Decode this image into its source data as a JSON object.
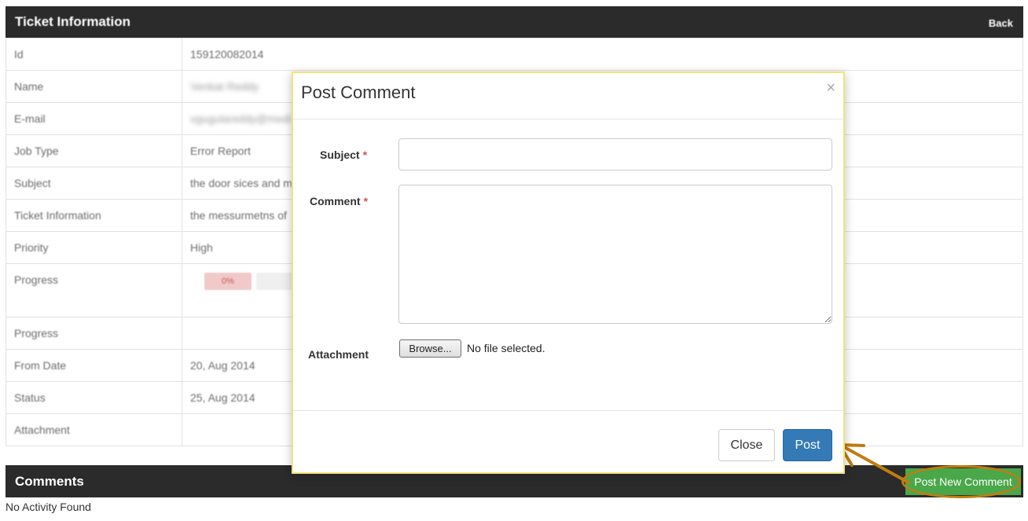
{
  "ticket_panel": {
    "title": "Ticket Information",
    "back_label": "Back",
    "rows": [
      {
        "key": "Id",
        "value": "159120082014"
      },
      {
        "key": "Name",
        "value": "Venkat Reddy"
      },
      {
        "key": "E-mail",
        "value": "vgugulareddy@medi"
      },
      {
        "key": "Job Type",
        "value": "Error Report"
      },
      {
        "key": "Subject",
        "value": "the door sices and m"
      },
      {
        "key": "Ticket Information",
        "value": "the messurmetns of"
      },
      {
        "key": "Priority",
        "value": "High"
      },
      {
        "key": "Progress",
        "value": "0%"
      },
      {
        "key": "Progress",
        "value": ""
      },
      {
        "key": "From Date",
        "value": "20, Aug 2014"
      },
      {
        "key": "Status",
        "value": "25, Aug 2014"
      },
      {
        "key": "Attachment",
        "value": ""
      }
    ]
  },
  "comments": {
    "title": "Comments",
    "post_new_label": "Post New Comment",
    "empty_text": "No Activity Found"
  },
  "modal": {
    "title": "Post Comment",
    "close_glyph": "×",
    "subject_label": "Subject",
    "comment_label": "Comment",
    "required_mark": "*",
    "attachment_label": "Attachment",
    "subject_value": "",
    "comment_value": "",
    "browse_label": "Browse...",
    "file_status": "No file selected.",
    "close_button": "Close",
    "post_button": "Post"
  },
  "colors": {
    "panel_dark": "#2b2b2b",
    "post_blue": "#337ab7",
    "post_new_green": "#4aa74a",
    "annotation_orange": "#c07d10",
    "modal_border": "#f3e27a",
    "required_red": "#d9534f"
  }
}
